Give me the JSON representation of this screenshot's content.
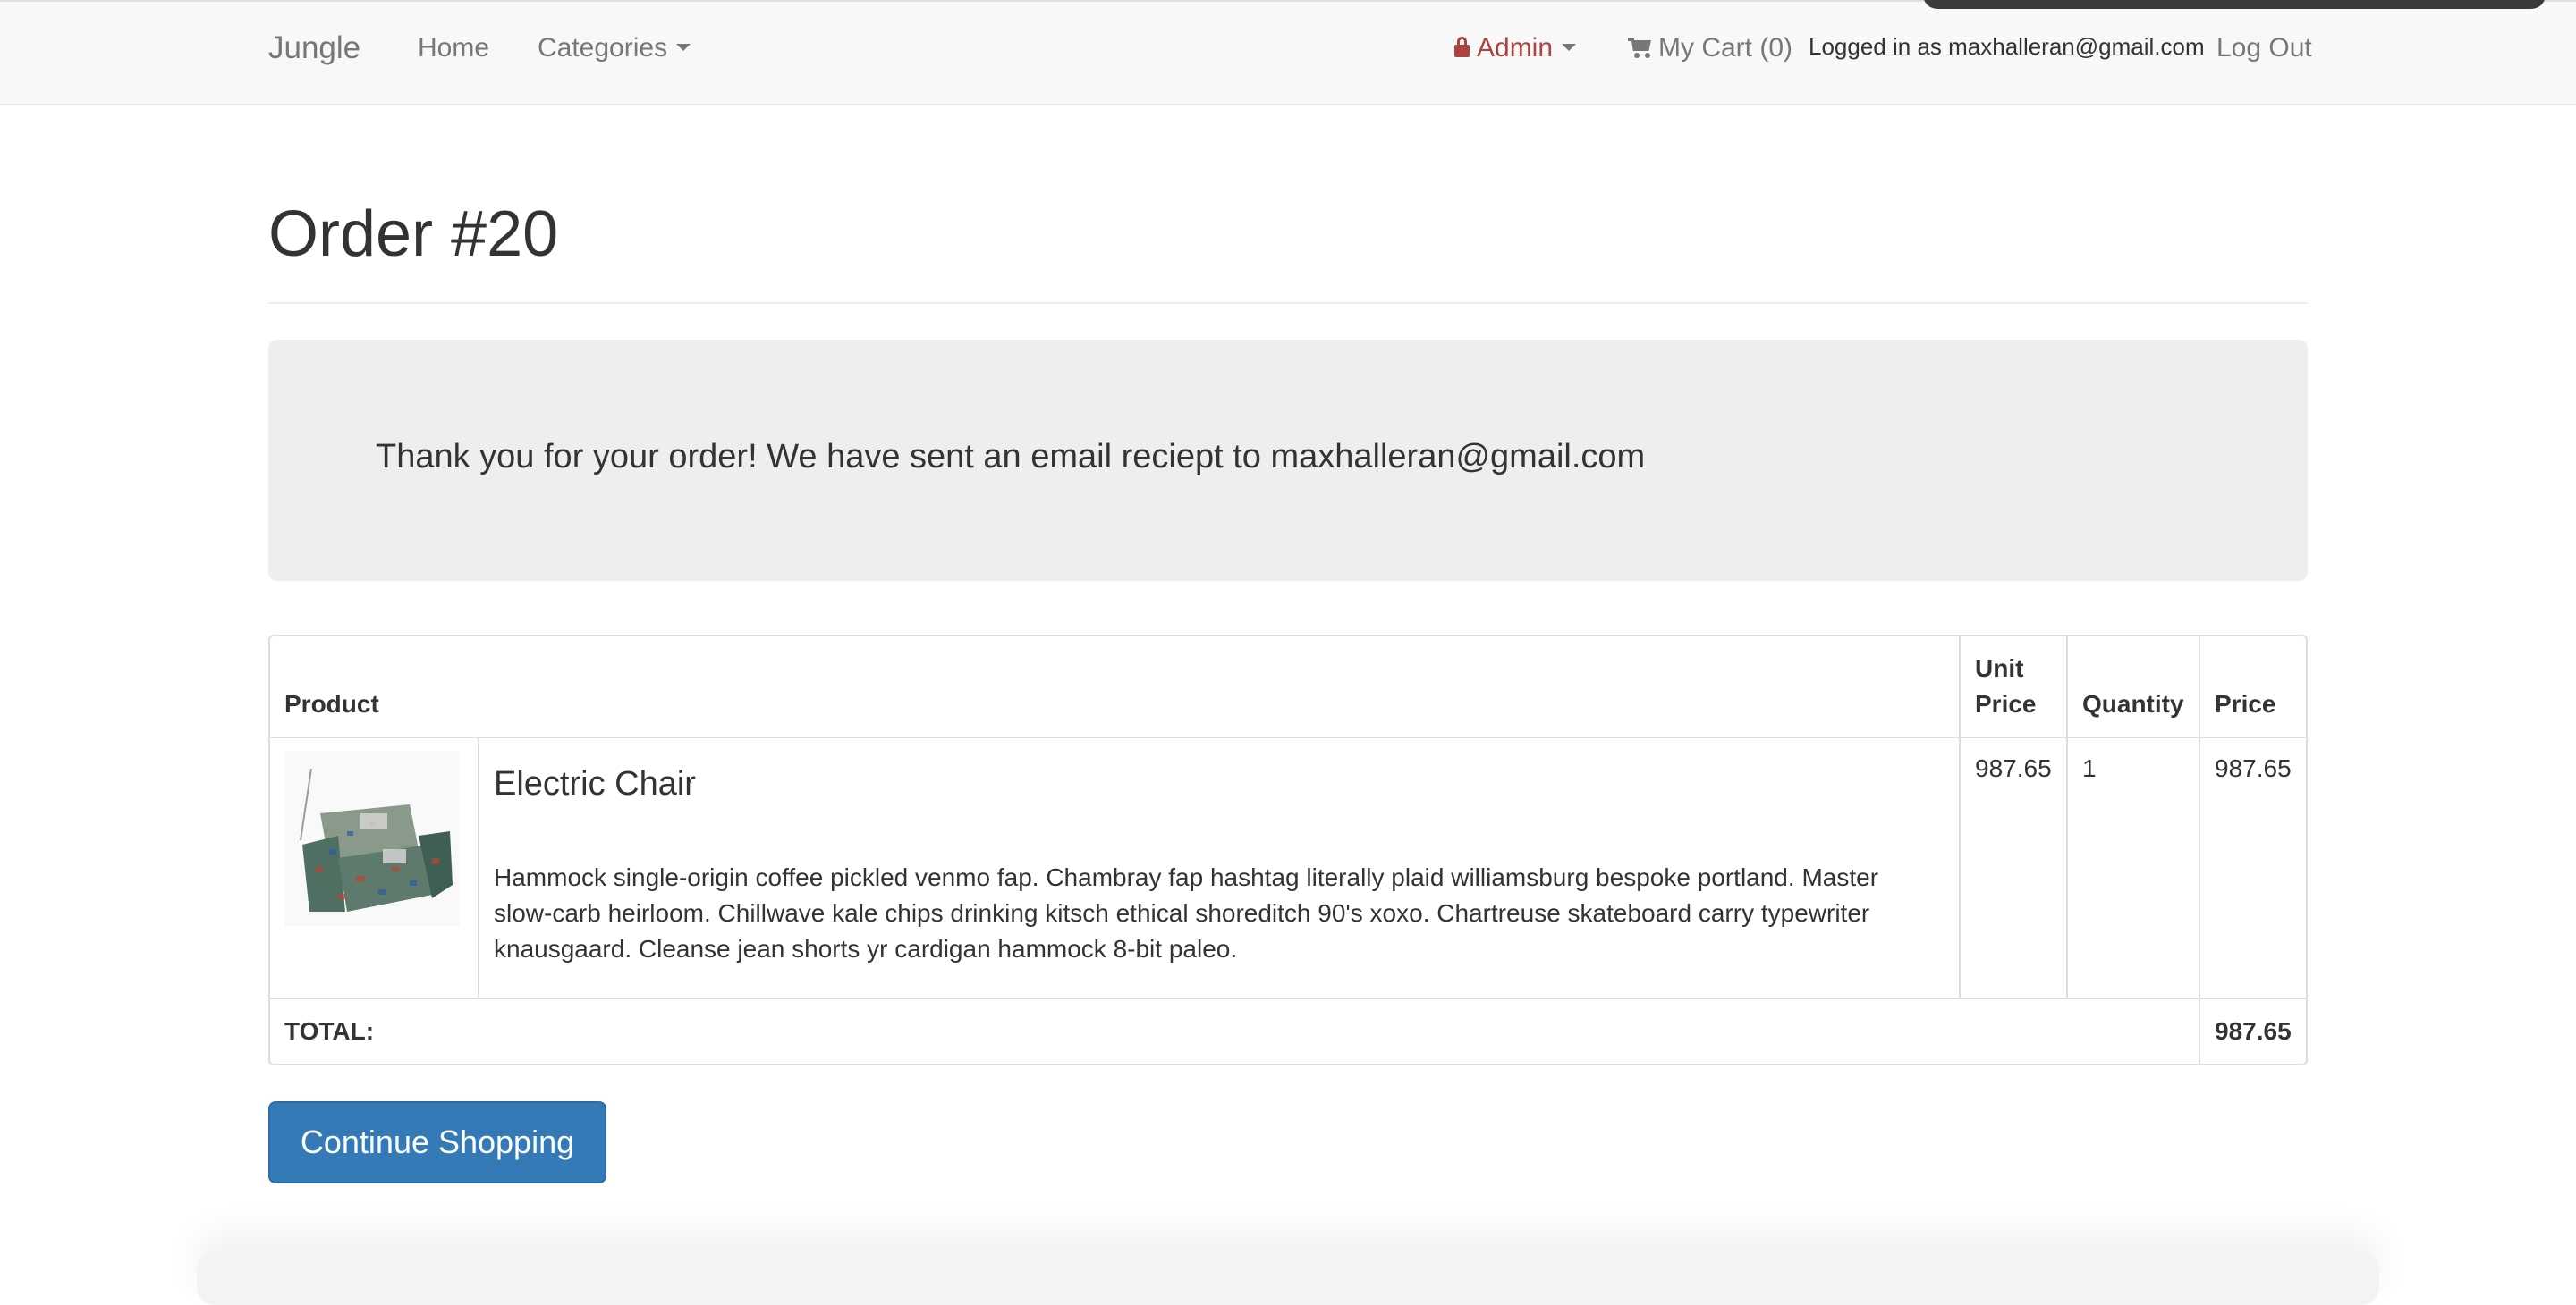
{
  "navbar": {
    "brand": "Jungle",
    "home": "Home",
    "categories": "Categories",
    "admin": "Admin",
    "cart": "My Cart (0)",
    "logged_in": "Logged in as maxhalleran@gmail.com",
    "logout": "Log Out"
  },
  "order": {
    "title": "Order #20",
    "thank_you": "Thank you for your order! We have sent an email reciept to maxhalleran@gmail.com"
  },
  "table": {
    "headers": {
      "product": "Product",
      "unit_price_line1": "Unit",
      "unit_price_line2": "Price",
      "quantity": "Quantity",
      "price": "Price"
    },
    "rows": [
      {
        "name": "Electric Chair",
        "description": "Hammock single-origin coffee pickled venmo fap. Chambray fap hashtag literally plaid williamsburg bespoke portland. Master slow-carb heirloom. Chillwave kale chips drinking kitsch ethical shoreditch 90's xoxo. Chartreuse skateboard carry typewriter knausgaard. Cleanse jean shorts yr cardigan hammock 8-bit paleo.",
        "unit_price": "987.65",
        "quantity": "1",
        "price": "987.65"
      }
    ],
    "total_label": "TOTAL:",
    "total_value": "987.65"
  },
  "actions": {
    "continue_shopping": "Continue Shopping"
  },
  "colors": {
    "primary": "#337ab7",
    "admin": "#a94442",
    "notice_bg": "#eeeeee",
    "navbar_bg": "#f8f8f8"
  },
  "icons": {
    "admin": "lock-icon",
    "cart": "shopping-cart-icon",
    "dropdown": "caret-down-icon"
  }
}
